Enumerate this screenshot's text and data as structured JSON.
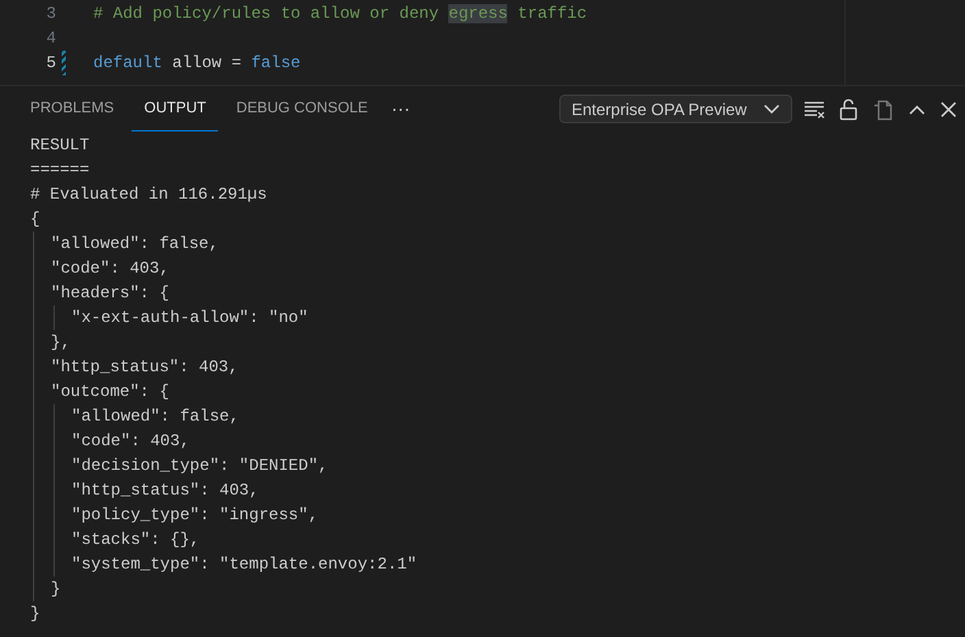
{
  "editor": {
    "lines": [
      {
        "number": "3",
        "current": false,
        "modified": false,
        "tokens": [
          {
            "kind": "comment",
            "text": "# Add policy/rules to allow or deny "
          },
          {
            "kind": "match",
            "text": "egress"
          },
          {
            "kind": "comment",
            "text": " traffic"
          }
        ]
      },
      {
        "number": "4",
        "current": false,
        "modified": false
      },
      {
        "number": "5",
        "current": true,
        "modified": true,
        "tokens": [
          {
            "kind": "keyword",
            "text": "default"
          },
          {
            "kind": "plain",
            "text": " allow = "
          },
          {
            "kind": "keyword",
            "text": "false"
          }
        ]
      }
    ]
  },
  "panel": {
    "tabs": [
      {
        "label": "PROBLEMS",
        "selected": false
      },
      {
        "label": "OUTPUT",
        "selected": true
      },
      {
        "label": "DEBUG CONSOLE",
        "selected": false
      }
    ],
    "more": "···",
    "channel": "Enterprise OPA Preview",
    "output": [
      {
        "text": "RESULT"
      },
      {
        "text": "======"
      },
      {
        "text": "# Evaluated in 116.291µs"
      },
      {
        "text": "{",
        "children": [
          {
            "text": "\"allowed\": false,"
          },
          {
            "text": "\"code\": 403,"
          },
          {
            "text": "\"headers\": {",
            "children": [
              {
                "text": "\"x-ext-auth-allow\": \"no\""
              }
            ]
          },
          {
            "text": "},"
          },
          {
            "text": "\"http_status\": 403,"
          },
          {
            "text": "\"outcome\": {",
            "children": [
              {
                "text": "\"allowed\": false,"
              },
              {
                "text": "\"code\": 403,"
              },
              {
                "text": "\"decision_type\": \"DENIED\","
              },
              {
                "text": "\"http_status\": 403,"
              },
              {
                "text": "\"policy_type\": \"ingress\","
              },
              {
                "text": "\"stacks\": {},"
              },
              {
                "text": "\"system_type\": \"template.envoy:2.1\""
              }
            ]
          },
          {
            "text": "}"
          }
        ]
      },
      {
        "text": "}"
      }
    ]
  }
}
